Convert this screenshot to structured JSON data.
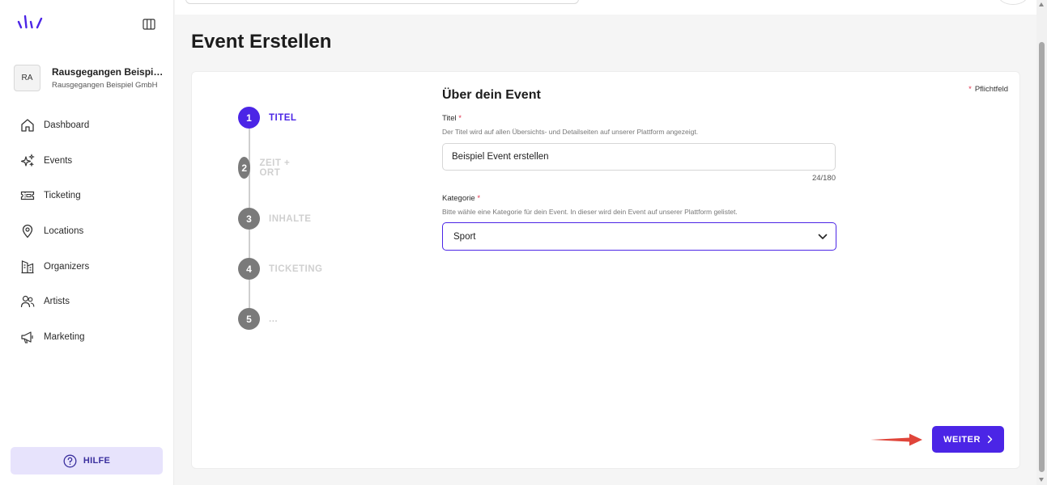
{
  "sidebar": {
    "org": {
      "avatar_initials": "RA",
      "name": "Rausgegangen Beispiel...",
      "subtitle": "Rausgegangen Beispiel GmbH"
    },
    "items": [
      {
        "label": "Dashboard",
        "icon": "home-icon"
      },
      {
        "label": "Events",
        "icon": "sparkles-icon"
      },
      {
        "label": "Ticketing",
        "icon": "ticket-icon"
      },
      {
        "label": "Locations",
        "icon": "map-pin-icon"
      },
      {
        "label": "Organizers",
        "icon": "building-icon"
      },
      {
        "label": "Artists",
        "icon": "users-icon"
      },
      {
        "label": "Marketing",
        "icon": "megaphone-icon"
      }
    ],
    "help_label": "HILFE"
  },
  "page": {
    "title": "Event Erstellen",
    "required_note": "Pflichtfeld",
    "required_star": "*"
  },
  "steps": [
    {
      "number": "1",
      "label": "TITEL",
      "active": true
    },
    {
      "number": "2",
      "label": "ZEIT + ORT",
      "active": false
    },
    {
      "number": "3",
      "label": "INHALTE",
      "active": false
    },
    {
      "number": "4",
      "label": "TICKETING",
      "active": false
    },
    {
      "number": "5",
      "label": "...",
      "active": false
    }
  ],
  "form": {
    "heading": "Über dein Event",
    "title_field": {
      "label": "Titel",
      "star": "*",
      "hint": "Der Titel wird auf allen Übersichts- und Detailseiten auf unserer Plattform angezeigt.",
      "value": "Beispiel Event erstellen",
      "counter": "24/180"
    },
    "category_field": {
      "label": "Kategorie",
      "star": "*",
      "hint": "Bitte wähle eine Kategorie für dein Event. In dieser wird dein Event auf unserer Plattform gelistet.",
      "value": "Sport"
    }
  },
  "actions": {
    "next_label": "WEITER"
  },
  "colors": {
    "accent": "#4b25e6",
    "required": "#e0314b",
    "annotation_arrow": "#e0453a",
    "help_bg": "#e7e3fc"
  }
}
